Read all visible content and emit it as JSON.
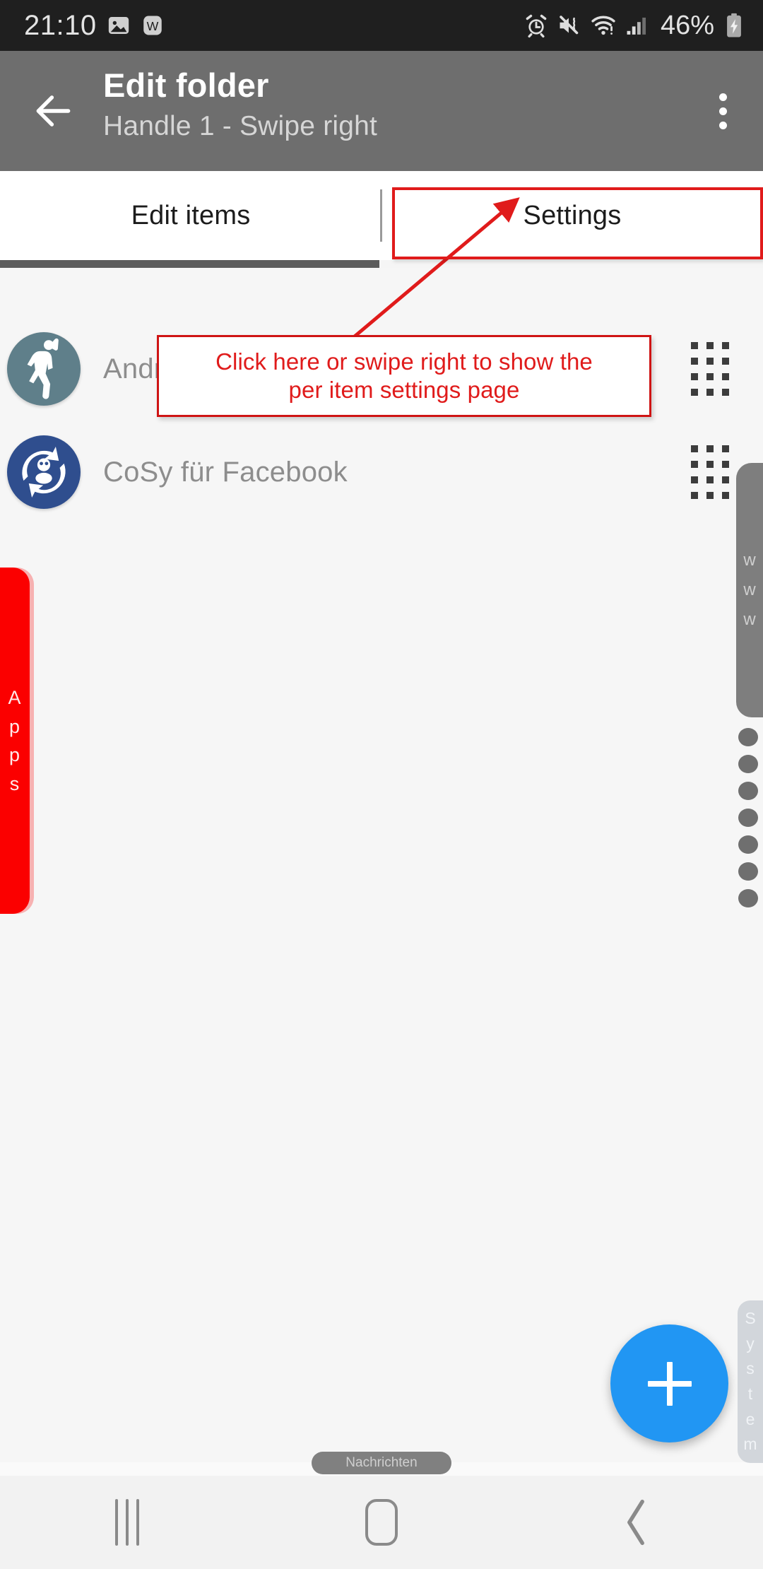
{
  "status_bar": {
    "time": "21:10",
    "battery_percent": "46%",
    "left_icons": [
      "image-icon",
      "wordpress-w-icon"
    ],
    "right_icons": [
      "alarm-icon",
      "mute-vibrate-icon",
      "wifi-warning-icon",
      "cell-signal-icon",
      "battery-charging-icon"
    ]
  },
  "app_bar": {
    "back_icon": "back-arrow-icon",
    "title": "Edit folder",
    "subtitle": "Handle 1 - Swipe right",
    "overflow_icon": "overflow-menu-icon"
  },
  "tabs": [
    {
      "label": "Edit items",
      "active": true
    },
    {
      "label": "Settings",
      "active": false
    }
  ],
  "list": {
    "items": [
      {
        "label": "AndroFit",
        "icon": "androfit-app-icon",
        "icon_color": "#5f7f8a",
        "handle_icon": "drag-handle-icon"
      },
      {
        "label": "CoSy für Facebook",
        "icon": "cosy-facebook-app-icon",
        "icon_color": "#2f4e8e",
        "handle_icon": "drag-handle-icon"
      }
    ]
  },
  "annotations": {
    "accent_color": "#e01b1b",
    "highlight_target": "Settings",
    "callout_line_1": "Click here or swipe right to show the",
    "callout_line_2": "per item settings page"
  },
  "edge_handles": [
    {
      "name": "Apps",
      "letters": [
        "A",
        "p",
        "p",
        "s"
      ],
      "color": "#fb0000"
    },
    {
      "name": "www",
      "letters": [
        "w",
        "w",
        "w"
      ],
      "color": "#7e7e7e"
    },
    {
      "name": "System",
      "letters": [
        "S",
        "y",
        "s",
        "t",
        "e",
        "m"
      ],
      "color": "#a0aab4"
    }
  ],
  "fab": {
    "label": "+",
    "color": "#2196f3",
    "icon": "plus-icon"
  },
  "toast": {
    "text": "Nachrichten"
  },
  "nav_bar": {
    "recents_icon": "recents-icon",
    "home_icon": "home-icon",
    "back_icon": "nav-back-icon"
  }
}
